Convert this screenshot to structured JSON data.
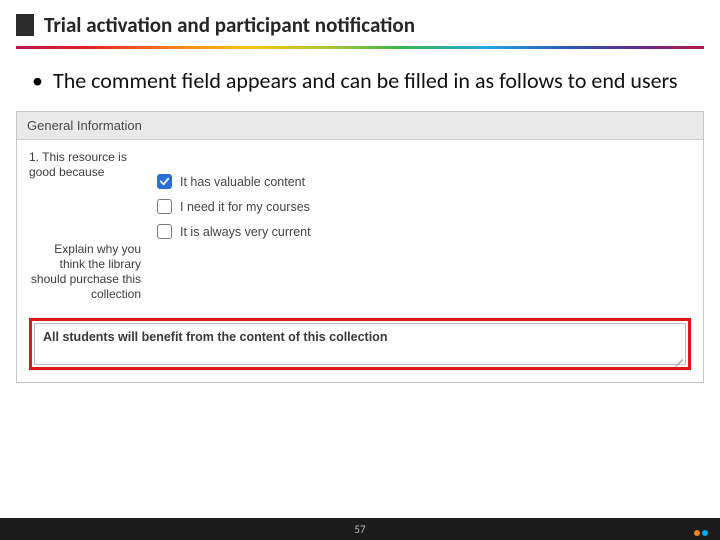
{
  "slide": {
    "title": "Trial activation and participant notification",
    "bullet": "The comment field appears and can be filled in as follows to end users",
    "page_number": "57"
  },
  "panel": {
    "header": "General Information",
    "question1_label": "1. This resource is good because",
    "question2_label": "Explain why you think the library should purchase this collection",
    "options": [
      {
        "label": "It has valuable content",
        "checked": true
      },
      {
        "label": "I need it for my courses",
        "checked": false
      },
      {
        "label": "It is always very current",
        "checked": false
      }
    ],
    "comment_value": "All students will benefit from the content of this collection"
  }
}
